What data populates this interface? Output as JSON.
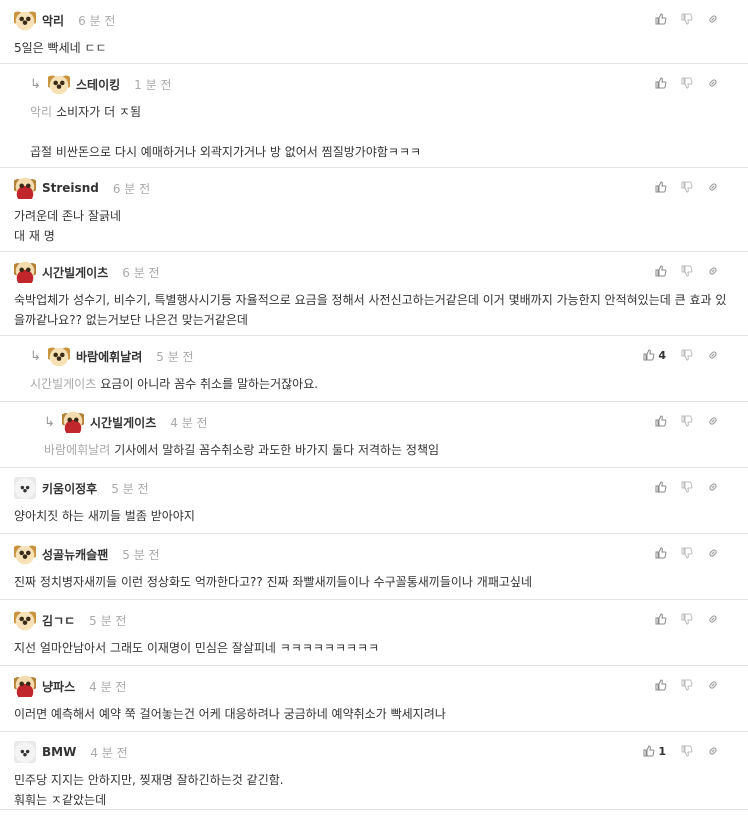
{
  "comments": [
    {
      "author": "악리",
      "time": "6 분 전",
      "avatar": "pup",
      "depth": 0,
      "mention": "",
      "text": "5일은 빡세네 ㄷㄷ",
      "likes": ""
    },
    {
      "author": "스테이킹",
      "time": "1 분 전",
      "avatar": "pup",
      "depth": 1,
      "mention": "악리",
      "text": "소비자가 더 ㅈ됨\n\n곱절 비싼돈으로 다시 예매하거나 외곽지가거나 방 없어서 찜질방가야함ㅋㅋㅋ",
      "likes": ""
    },
    {
      "author": "Streisnd",
      "time": "6 분 전",
      "avatar": "redpup",
      "depth": 0,
      "mention": "",
      "text": "가려운데 존나 잘긁네\n대 재 명",
      "likes": ""
    },
    {
      "author": "시간빌게이츠",
      "time": "6 분 전",
      "avatar": "redpup",
      "depth": 0,
      "mention": "",
      "text": "숙박업체가 성수기, 비수기, 특별행사시기등 자율적으로 요금을 정해서 사전신고하는거같은데 이거 몇배까지 가능한지 안적혀있는데 큰 효과 있을까같나요?? 없는거보단 나은건 맞는거같은데",
      "likes": ""
    },
    {
      "author": "바람에휘날려",
      "time": "5 분 전",
      "avatar": "pup",
      "depth": 1,
      "mention": "시간빌게이츠",
      "text": "요금이 아니라 꼼수 취소를 말하는거잖아요.",
      "likes": "4"
    },
    {
      "author": "시간빌게이츠",
      "time": "4 분 전",
      "avatar": "redpup",
      "depth": 2,
      "mention": "바람에휘날려",
      "text": "기사에서 말하길 꼼수취소랑 과도한 바가지 둘다 저격하는 정책임",
      "likes": ""
    },
    {
      "author": "키움이정후",
      "time": "5 분 전",
      "avatar": "white",
      "depth": 0,
      "mention": "",
      "text": "양아치짓 하는 새끼들 벌좀 받아야지",
      "likes": ""
    },
    {
      "author": "성골뉴캐슬팬",
      "time": "5 분 전",
      "avatar": "pup",
      "depth": 0,
      "mention": "",
      "text": "진짜 정치병자새끼들 이런 정상화도 억까한다고?? 진짜 좌빨새끼들이나 수구꼴통새끼들이나 개패고싶네",
      "likes": ""
    },
    {
      "author": "김ㄱㄷ",
      "time": "5 분 전",
      "avatar": "pup",
      "depth": 0,
      "mention": "",
      "text": "지선 얼마안남아서 그래도 이재명이 민심은 잘살피네 ㅋㅋㅋㅋㅋㅋㅋㅋㅋ",
      "likes": ""
    },
    {
      "author": "냥파스",
      "time": "4 분 전",
      "avatar": "redpup",
      "depth": 0,
      "mention": "",
      "text": "이러면 예측해서 예약 쭉 걸어놓는건 어케 대응하려나 궁금하네 예약취소가 빡세지려나",
      "likes": ""
    },
    {
      "author": "BMW",
      "time": "4 분 전",
      "avatar": "white",
      "depth": 0,
      "mention": "",
      "text": "민주당 지지는 안하지만, 찢재명 잘하긴하는것 같긴함.\n훠훠는 ㅈ같았는데",
      "likes": "1"
    }
  ]
}
